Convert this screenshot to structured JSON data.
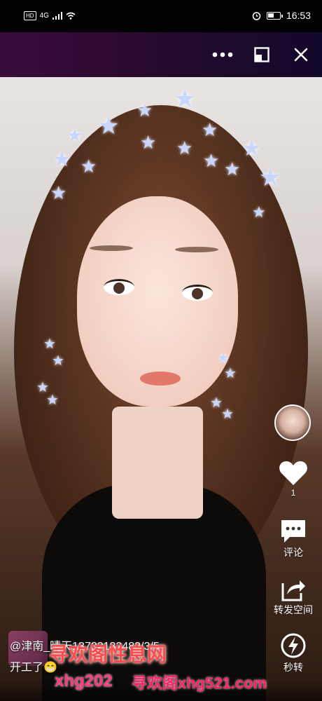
{
  "status_bar": {
    "network": "4G",
    "time": "16:53"
  },
  "top_bar": {
    "more_icon": "more-icon",
    "pip_icon": "pip-icon",
    "close_icon": "close-icon"
  },
  "rail": {
    "like_count": "1",
    "comment_label": "评论",
    "share_label": "转发空间",
    "quick_share_label": "秒转"
  },
  "caption": {
    "author_line": "@津南_晴天18722182482/3/5",
    "text": "开工了😁"
  },
  "watermarks": {
    "line1": "寻欢阁性息网",
    "line2": "xhg202",
    "line3": "寻欢阁xhg521.com"
  }
}
